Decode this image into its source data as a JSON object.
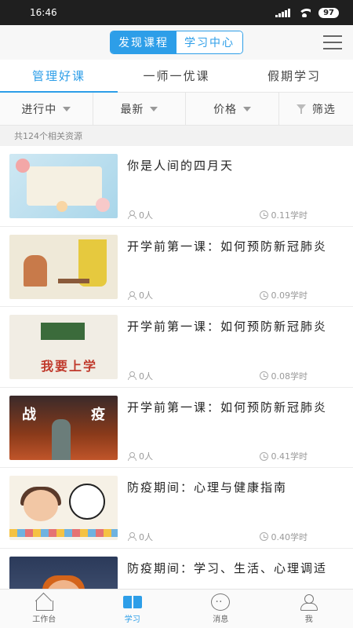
{
  "status": {
    "time": "16:46",
    "battery": "97"
  },
  "header": {
    "segment": [
      {
        "label": "发现课程",
        "selected": true
      },
      {
        "label": "学习中心",
        "selected": false
      }
    ]
  },
  "tabs": [
    {
      "label": "管理好课",
      "active": true
    },
    {
      "label": "一师一优课",
      "active": false
    },
    {
      "label": "假期学习",
      "active": false
    }
  ],
  "filters": {
    "status": "进行中",
    "sort": "最新",
    "price": "价格",
    "filter": "筛选"
  },
  "count_text": "共124个相关资源",
  "courses": [
    {
      "title": "你是人间的四月天",
      "learners": "0人",
      "hours": "0.11学时"
    },
    {
      "title": "开学前第一课：如何预防新冠肺炎",
      "learners": "0人",
      "hours": "0.09学时"
    },
    {
      "title": "开学前第一课：如何预防新冠肺炎",
      "learners": "0人",
      "hours": "0.08学时"
    },
    {
      "title": "开学前第一课：如何预防新冠肺炎",
      "learners": "0人",
      "hours": "0.41学时"
    },
    {
      "title": "防疫期间：心理与健康指南",
      "learners": "0人",
      "hours": "0.40学时"
    },
    {
      "title": "防疫期间：学习、生活、心理调适",
      "learners": "",
      "hours": ""
    }
  ],
  "thumb_text": {
    "t3": "我要上学",
    "t4a": "战",
    "t4b": "疫"
  },
  "bottom_nav": [
    {
      "label": "工作台",
      "icon": "home-icon",
      "active": false
    },
    {
      "label": "学习",
      "icon": "book-icon",
      "active": true
    },
    {
      "label": "消息",
      "icon": "message-icon",
      "active": false
    },
    {
      "label": "我",
      "icon": "profile-icon",
      "active": false
    }
  ],
  "colors": {
    "accent": "#2d9ee8"
  }
}
